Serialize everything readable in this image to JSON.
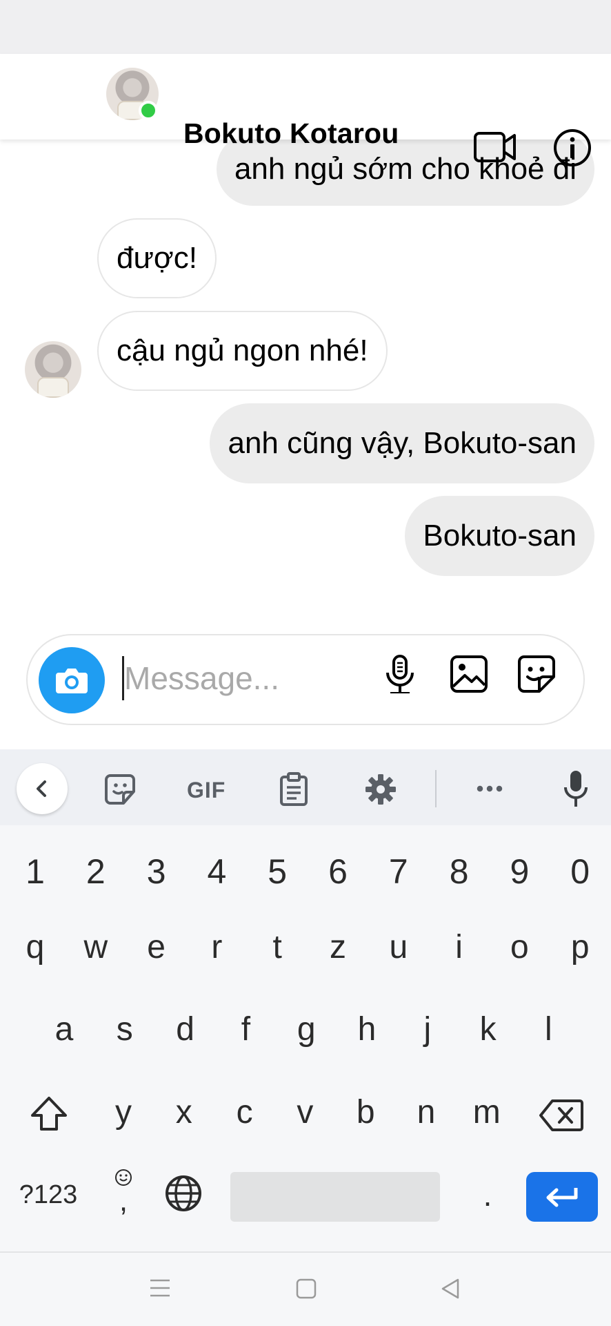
{
  "header": {
    "contact_name": "Bokuto Kotarou",
    "online": true,
    "icons": [
      "video-camera-icon",
      "info-icon"
    ]
  },
  "messages": [
    {
      "side": "out",
      "text": "anh ngủ sớm cho khoẻ đi"
    },
    {
      "side": "in",
      "text": "được!"
    },
    {
      "side": "in",
      "text": "cậu ngủ ngon nhé!"
    },
    {
      "side": "out",
      "text": "anh cũng vậy, Bokuto-san"
    },
    {
      "side": "out",
      "text": "Bokuto-san"
    }
  ],
  "composer": {
    "placeholder": "Message...",
    "value": "",
    "icons": [
      "camera-icon",
      "microphone-icon",
      "image-icon",
      "sticker-icon"
    ]
  },
  "keyboard_toolbar": {
    "gif_label": "GIF",
    "icons": [
      "chevron-left-icon",
      "sticker-icon",
      "clipboard-icon",
      "settings-gear-icon",
      "more-icon",
      "microphone-icon"
    ]
  },
  "keyboard": {
    "rows": [
      [
        "1",
        "2",
        "3",
        "4",
        "5",
        "6",
        "7",
        "8",
        "9",
        "0"
      ],
      [
        "q",
        "w",
        "e",
        "r",
        "t",
        "z",
        "u",
        "i",
        "o",
        "p"
      ],
      [
        "a",
        "s",
        "d",
        "f",
        "g",
        "h",
        "j",
        "k",
        "l"
      ],
      [
        "y",
        "x",
        "c",
        "v",
        "b",
        "n",
        "m"
      ]
    ],
    "symbols_label": "?123",
    "comma": ",",
    "period": ".",
    "icons": [
      "shift-icon",
      "backspace-icon",
      "smiley-icon",
      "globe-icon",
      "enter-icon"
    ]
  },
  "nav_bar": {
    "icons": [
      "menu-icon",
      "home-square-icon",
      "back-triangle-icon"
    ]
  },
  "colors": {
    "accent_blue": "#1f9df2",
    "enter_blue": "#1a73e8",
    "online_green": "#31cc46",
    "outgoing_bubble": "#ececec"
  }
}
